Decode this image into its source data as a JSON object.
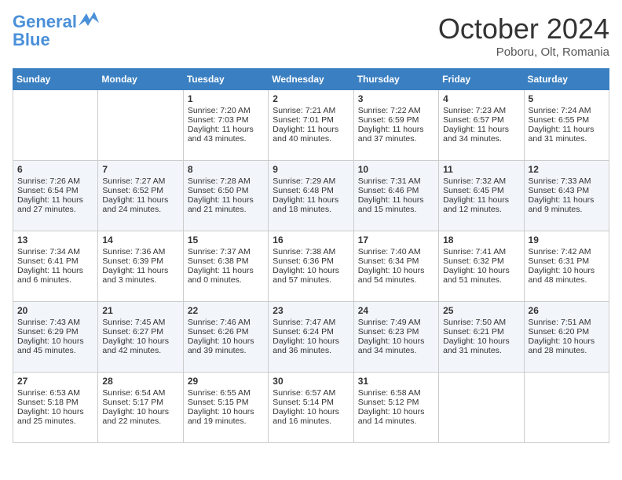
{
  "header": {
    "logo_line1": "General",
    "logo_line2": "Blue",
    "month": "October 2024",
    "location": "Poboru, Olt, Romania"
  },
  "days_of_week": [
    "Sunday",
    "Monday",
    "Tuesday",
    "Wednesday",
    "Thursday",
    "Friday",
    "Saturday"
  ],
  "weeks": [
    [
      {
        "day": "",
        "sunrise": "",
        "sunset": "",
        "daylight": ""
      },
      {
        "day": "",
        "sunrise": "",
        "sunset": "",
        "daylight": ""
      },
      {
        "day": "1",
        "sunrise": "Sunrise: 7:20 AM",
        "sunset": "Sunset: 7:03 PM",
        "daylight": "Daylight: 11 hours and 43 minutes."
      },
      {
        "day": "2",
        "sunrise": "Sunrise: 7:21 AM",
        "sunset": "Sunset: 7:01 PM",
        "daylight": "Daylight: 11 hours and 40 minutes."
      },
      {
        "day": "3",
        "sunrise": "Sunrise: 7:22 AM",
        "sunset": "Sunset: 6:59 PM",
        "daylight": "Daylight: 11 hours and 37 minutes."
      },
      {
        "day": "4",
        "sunrise": "Sunrise: 7:23 AM",
        "sunset": "Sunset: 6:57 PM",
        "daylight": "Daylight: 11 hours and 34 minutes."
      },
      {
        "day": "5",
        "sunrise": "Sunrise: 7:24 AM",
        "sunset": "Sunset: 6:55 PM",
        "daylight": "Daylight: 11 hours and 31 minutes."
      }
    ],
    [
      {
        "day": "6",
        "sunrise": "Sunrise: 7:26 AM",
        "sunset": "Sunset: 6:54 PM",
        "daylight": "Daylight: 11 hours and 27 minutes."
      },
      {
        "day": "7",
        "sunrise": "Sunrise: 7:27 AM",
        "sunset": "Sunset: 6:52 PM",
        "daylight": "Daylight: 11 hours and 24 minutes."
      },
      {
        "day": "8",
        "sunrise": "Sunrise: 7:28 AM",
        "sunset": "Sunset: 6:50 PM",
        "daylight": "Daylight: 11 hours and 21 minutes."
      },
      {
        "day": "9",
        "sunrise": "Sunrise: 7:29 AM",
        "sunset": "Sunset: 6:48 PM",
        "daylight": "Daylight: 11 hours and 18 minutes."
      },
      {
        "day": "10",
        "sunrise": "Sunrise: 7:31 AM",
        "sunset": "Sunset: 6:46 PM",
        "daylight": "Daylight: 11 hours and 15 minutes."
      },
      {
        "day": "11",
        "sunrise": "Sunrise: 7:32 AM",
        "sunset": "Sunset: 6:45 PM",
        "daylight": "Daylight: 11 hours and 12 minutes."
      },
      {
        "day": "12",
        "sunrise": "Sunrise: 7:33 AM",
        "sunset": "Sunset: 6:43 PM",
        "daylight": "Daylight: 11 hours and 9 minutes."
      }
    ],
    [
      {
        "day": "13",
        "sunrise": "Sunrise: 7:34 AM",
        "sunset": "Sunset: 6:41 PM",
        "daylight": "Daylight: 11 hours and 6 minutes."
      },
      {
        "day": "14",
        "sunrise": "Sunrise: 7:36 AM",
        "sunset": "Sunset: 6:39 PM",
        "daylight": "Daylight: 11 hours and 3 minutes."
      },
      {
        "day": "15",
        "sunrise": "Sunrise: 7:37 AM",
        "sunset": "Sunset: 6:38 PM",
        "daylight": "Daylight: 11 hours and 0 minutes."
      },
      {
        "day": "16",
        "sunrise": "Sunrise: 7:38 AM",
        "sunset": "Sunset: 6:36 PM",
        "daylight": "Daylight: 10 hours and 57 minutes."
      },
      {
        "day": "17",
        "sunrise": "Sunrise: 7:40 AM",
        "sunset": "Sunset: 6:34 PM",
        "daylight": "Daylight: 10 hours and 54 minutes."
      },
      {
        "day": "18",
        "sunrise": "Sunrise: 7:41 AM",
        "sunset": "Sunset: 6:32 PM",
        "daylight": "Daylight: 10 hours and 51 minutes."
      },
      {
        "day": "19",
        "sunrise": "Sunrise: 7:42 AM",
        "sunset": "Sunset: 6:31 PM",
        "daylight": "Daylight: 10 hours and 48 minutes."
      }
    ],
    [
      {
        "day": "20",
        "sunrise": "Sunrise: 7:43 AM",
        "sunset": "Sunset: 6:29 PM",
        "daylight": "Daylight: 10 hours and 45 minutes."
      },
      {
        "day": "21",
        "sunrise": "Sunrise: 7:45 AM",
        "sunset": "Sunset: 6:27 PM",
        "daylight": "Daylight: 10 hours and 42 minutes."
      },
      {
        "day": "22",
        "sunrise": "Sunrise: 7:46 AM",
        "sunset": "Sunset: 6:26 PM",
        "daylight": "Daylight: 10 hours and 39 minutes."
      },
      {
        "day": "23",
        "sunrise": "Sunrise: 7:47 AM",
        "sunset": "Sunset: 6:24 PM",
        "daylight": "Daylight: 10 hours and 36 minutes."
      },
      {
        "day": "24",
        "sunrise": "Sunrise: 7:49 AM",
        "sunset": "Sunset: 6:23 PM",
        "daylight": "Daylight: 10 hours and 34 minutes."
      },
      {
        "day": "25",
        "sunrise": "Sunrise: 7:50 AM",
        "sunset": "Sunset: 6:21 PM",
        "daylight": "Daylight: 10 hours and 31 minutes."
      },
      {
        "day": "26",
        "sunrise": "Sunrise: 7:51 AM",
        "sunset": "Sunset: 6:20 PM",
        "daylight": "Daylight: 10 hours and 28 minutes."
      }
    ],
    [
      {
        "day": "27",
        "sunrise": "Sunrise: 6:53 AM",
        "sunset": "Sunset: 5:18 PM",
        "daylight": "Daylight: 10 hours and 25 minutes."
      },
      {
        "day": "28",
        "sunrise": "Sunrise: 6:54 AM",
        "sunset": "Sunset: 5:17 PM",
        "daylight": "Daylight: 10 hours and 22 minutes."
      },
      {
        "day": "29",
        "sunrise": "Sunrise: 6:55 AM",
        "sunset": "Sunset: 5:15 PM",
        "daylight": "Daylight: 10 hours and 19 minutes."
      },
      {
        "day": "30",
        "sunrise": "Sunrise: 6:57 AM",
        "sunset": "Sunset: 5:14 PM",
        "daylight": "Daylight: 10 hours and 16 minutes."
      },
      {
        "day": "31",
        "sunrise": "Sunrise: 6:58 AM",
        "sunset": "Sunset: 5:12 PM",
        "daylight": "Daylight: 10 hours and 14 minutes."
      },
      {
        "day": "",
        "sunrise": "",
        "sunset": "",
        "daylight": ""
      },
      {
        "day": "",
        "sunrise": "",
        "sunset": "",
        "daylight": ""
      }
    ]
  ]
}
